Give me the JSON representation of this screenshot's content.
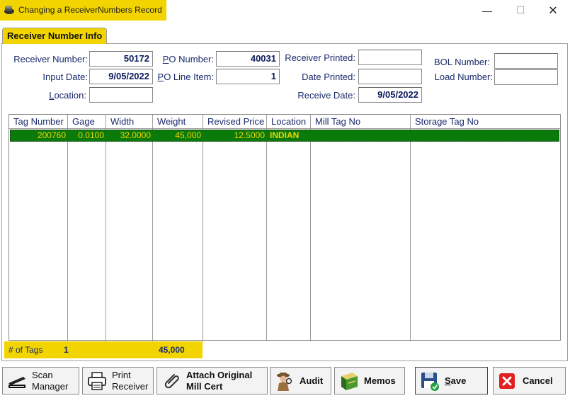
{
  "window": {
    "title": "Changing a ReceiverNumbers Record",
    "controls": {
      "minimize": "—",
      "maximize": "☐",
      "close": "✕"
    }
  },
  "tabs": [
    {
      "label": "Receiver Number Info",
      "active": true
    }
  ],
  "form": {
    "receiver_number": {
      "label": "Receiver Number:",
      "value": "50172"
    },
    "input_date": {
      "label": "Input Date:",
      "value": "9/05/2022"
    },
    "location": {
      "label_prefix": "L",
      "label_rest": "ocation:",
      "value": ""
    },
    "po_number": {
      "label_prefix": "P",
      "label_rest": "O Number:",
      "value": "40031"
    },
    "po_line_item": {
      "label_prefix": "P",
      "label_rest": "O Line Item:",
      "value": "1"
    },
    "receiver_printed": {
      "label": "Receiver Printed:",
      "value": ""
    },
    "date_printed": {
      "label": "Date Printed:",
      "value": ""
    },
    "receive_date": {
      "label": "Receive Date:",
      "value": "9/05/2022"
    },
    "bol_number": {
      "label": "BOL Number:",
      "value": ""
    },
    "load_number": {
      "label": "Load Number:",
      "value": ""
    }
  },
  "grid": {
    "columns": [
      "Tag Number",
      "Gage",
      "Width",
      "Weight",
      "Revised Price",
      "Location",
      "Mill Tag No",
      "Storage Tag No"
    ],
    "rows": [
      {
        "tag_number": "200760",
        "gage": "0.0100",
        "width": "32.0000",
        "weight": "45,000",
        "revised_price": "12.5000",
        "location": "INDIAN",
        "mill_tag_no": "",
        "storage_tag_no": "",
        "selected": true
      }
    ],
    "selected_row_color": "#0a7a0a",
    "selected_text_color": "#f2d500"
  },
  "totals": {
    "label": "# of Tags",
    "count": "1",
    "weight": "45,000"
  },
  "buttons": {
    "scan_manager": {
      "line1": "Scan",
      "line2": "Manager",
      "icon": "scanner-icon"
    },
    "print_receiver": {
      "line1": "Print",
      "line2": "Receiver",
      "icon": "printer-icon"
    },
    "attach_cert": {
      "line1": "Attach Original",
      "line2": "Mill Cert",
      "icon": "paperclip-icon"
    },
    "audit": {
      "label": "Audit",
      "icon": "detective-icon"
    },
    "memos": {
      "label": "Memos",
      "icon": "book-icon"
    },
    "save": {
      "label_prefix": "S",
      "label_rest": "ave",
      "icon": "floppy-disk-icon"
    },
    "cancel": {
      "label": "Cancel",
      "icon": "red-x-icon"
    }
  },
  "colors": {
    "accent_yellow": "#f2d500",
    "label_blue": "#1a2a6c",
    "cancel_red": "#e02020"
  }
}
